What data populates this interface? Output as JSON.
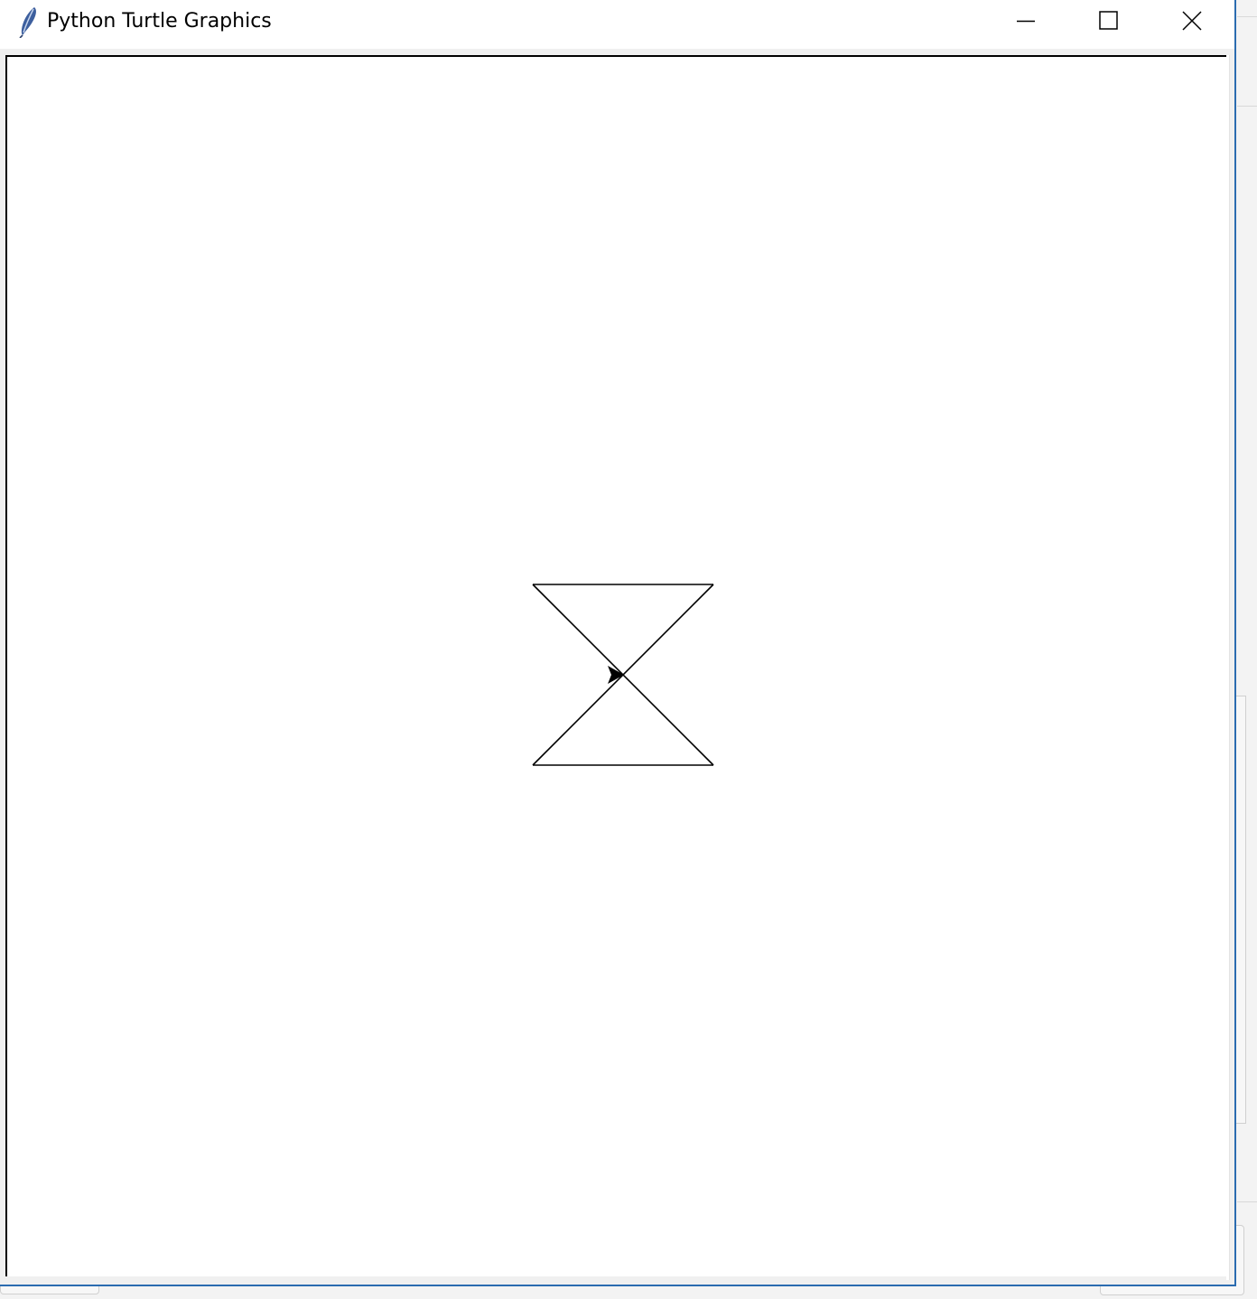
{
  "window": {
    "title": "Python Turtle Graphics",
    "icon": "feather-icon",
    "controls": {
      "minimize_icon": "minimize-icon",
      "maximize_icon": "maximize-icon",
      "close_icon": "close-icon"
    }
  },
  "canvas": {
    "background": "#ffffff",
    "pen_color": "#000000",
    "turtle_shape": "arrow",
    "turtle_heading": "east",
    "drawing": "hourglass"
  }
}
